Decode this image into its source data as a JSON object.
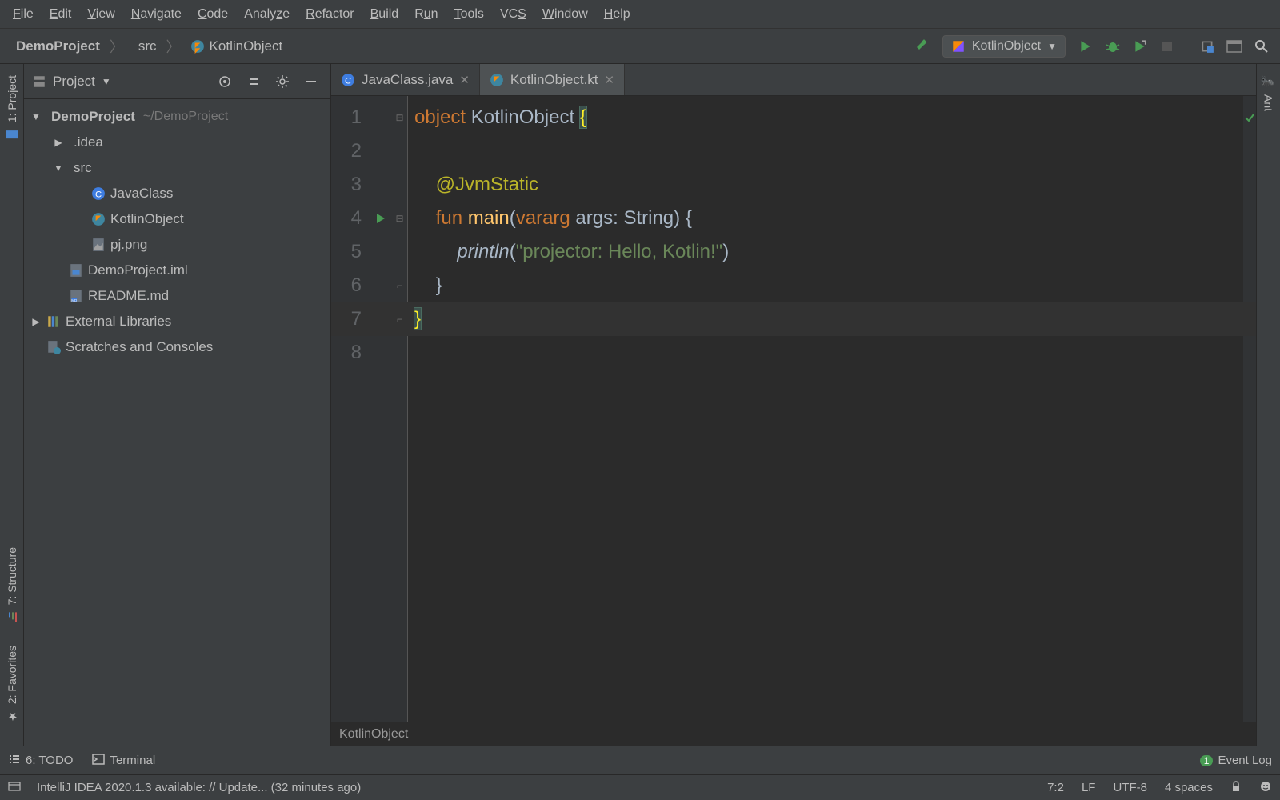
{
  "menu": [
    "File",
    "Edit",
    "View",
    "Navigate",
    "Code",
    "Analyze",
    "Refactor",
    "Build",
    "Run",
    "Tools",
    "VCS",
    "Window",
    "Help"
  ],
  "breadcrumb": {
    "project": "DemoProject",
    "src": "src",
    "file": "KotlinObject"
  },
  "run_config": "KotlinObject",
  "panel": {
    "title": "Project"
  },
  "tree": {
    "root": {
      "name": "DemoProject",
      "path": "~/DemoProject"
    },
    "idea": ".idea",
    "src": "src",
    "javaClass": "JavaClass",
    "kotlinObject": "KotlinObject",
    "pj": "pj.png",
    "iml": "DemoProject.iml",
    "readme": "README.md",
    "ext": "External Libraries",
    "scratch": "Scratches and Consoles"
  },
  "tabs": [
    {
      "label": "JavaClass.java"
    },
    {
      "label": "KotlinObject.kt"
    }
  ],
  "code": {
    "obj_kw": "object",
    "obj_name": " KotlinObject ",
    "brace_open": "{",
    "annotation": "@JvmStatic",
    "fun_kw": "fun",
    "fn_name": " main",
    "params_open": "(",
    "vararg": "vararg",
    "args": " args: String) ",
    "body_open": "{",
    "println": "println",
    "call_open": "(",
    "string": "\"projector: Hello, Kotlin!\"",
    "call_close": ")",
    "body_close": "}",
    "obj_close": "}"
  },
  "line_numbers": [
    "1",
    "2",
    "3",
    "4",
    "5",
    "6",
    "7",
    "8"
  ],
  "crumb_bottom": "KotlinObject",
  "bottom_tools": {
    "todo": "6: TODO",
    "terminal": "Terminal",
    "event_log": "Event Log",
    "event_count": "1"
  },
  "status": {
    "msg": "IntelliJ IDEA 2020.1.3 available: // Update... (32 minutes ago)",
    "pos": "7:2",
    "le": "LF",
    "enc": "UTF-8",
    "indent": "4 spaces"
  },
  "left_strip": {
    "project": "1: Project",
    "structure": "7: Structure",
    "favorites": "2: Favorites"
  },
  "right_strip": {
    "ant": "Ant"
  }
}
